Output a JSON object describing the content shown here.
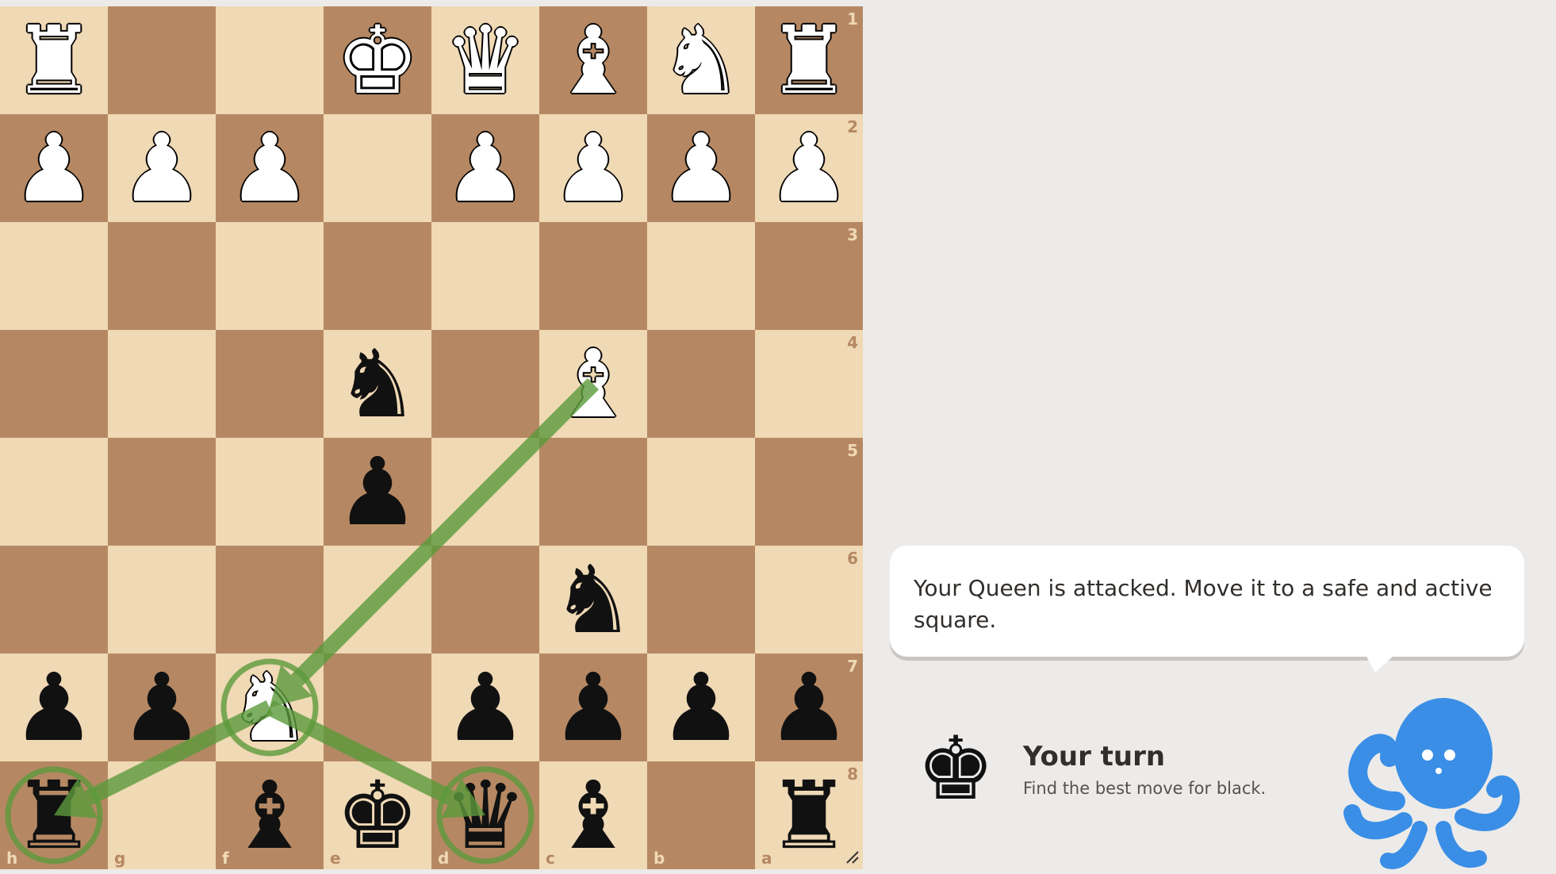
{
  "board": {
    "orientation": "black",
    "colors": {
      "light": "#f0d9b5",
      "dark": "#b58863"
    },
    "files_display": [
      "h",
      "g",
      "f",
      "e",
      "d",
      "c",
      "b",
      "a"
    ],
    "ranks_display": [
      "1",
      "2",
      "3",
      "4",
      "5",
      "6",
      "7",
      "8"
    ],
    "rows": [
      [
        "wR",
        "",
        "",
        "wK",
        "wQ",
        "wB",
        "wN",
        "wR"
      ],
      [
        "wP",
        "wP",
        "wP",
        "",
        "wP",
        "wP",
        "wP",
        "wP"
      ],
      [
        "",
        "",
        "",
        "",
        "",
        "",
        "",
        ""
      ],
      [
        "",
        "",
        "",
        "bN",
        "",
        "wB",
        "",
        ""
      ],
      [
        "",
        "",
        "",
        "bP",
        "",
        "",
        "",
        ""
      ],
      [
        "",
        "",
        "",
        "",
        "",
        "bN",
        "",
        ""
      ],
      [
        "bP",
        "bP",
        "wN",
        "",
        "bP",
        "bP",
        "bP",
        "bP"
      ],
      [
        "bR",
        "",
        "bB",
        "bK",
        "bQ",
        "bB",
        "",
        "bR"
      ]
    ],
    "arrows": [
      {
        "from": "c4",
        "to": "f7",
        "color": "#5c9a3c"
      },
      {
        "from": "f7",
        "to": "h8",
        "color": "#5c9a3c"
      },
      {
        "from": "f7",
        "to": "d8",
        "color": "#5c9a3c"
      }
    ],
    "circles": [
      {
        "square": "f7",
        "color": "#5c9a3c"
      },
      {
        "square": "h8",
        "color": "#5c9a3c"
      },
      {
        "square": "d8",
        "color": "#5c9a3c"
      }
    ]
  },
  "coach": {
    "message": "Your Queen is attacked. Move it to a safe and active square.",
    "avatar_icon": "octopus-icon",
    "avatar_color": "#3a8ee6"
  },
  "turn": {
    "piece": "bK",
    "title": "Your turn",
    "subtitle": "Find the best move for black."
  }
}
